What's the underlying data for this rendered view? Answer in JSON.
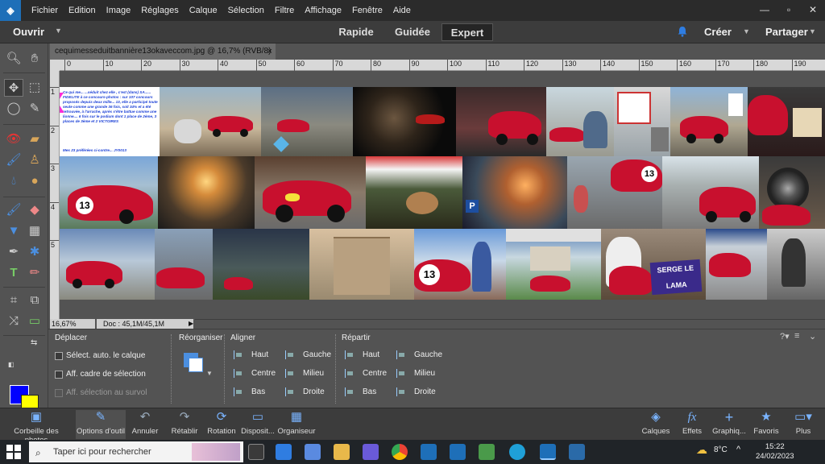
{
  "menu": [
    "Fichier",
    "Edition",
    "Image",
    "Réglages",
    "Calque",
    "Sélection",
    "Filtre",
    "Affichage",
    "Fenêtre",
    "Aide"
  ],
  "window_controls": [
    "—",
    "▫",
    "✕"
  ],
  "modebar": {
    "open": "Ouvrir",
    "tabs": [
      "Rapide",
      "Guidée",
      "Expert"
    ],
    "active_tab": "Expert",
    "create": "Créer",
    "share": "Partager"
  },
  "document": {
    "tab_title": "cequimesseduitbannière13okaveccom.jpg @ 16,7% (RVB/8)",
    "close": "×",
    "zoom": "16,67%",
    "doc_size": "Doc : 45,1M/45,1M"
  },
  "ruler_top": [
    "0",
    "10",
    "20",
    "30",
    "40",
    "50",
    "60",
    "70",
    "80",
    "90",
    "100",
    "110",
    "120",
    "130",
    "140",
    "150",
    "160",
    "170",
    "180",
    "190"
  ],
  "ruler_left": [
    "1",
    "2",
    "3",
    "4",
    "5"
  ],
  "canvas_text": {
    "collage_caption": "Ce qui me... ...séduit chez elle , c'est (dans) SA...... FIDELITE à ce concours-photos : sur 107 concours proposés depuis deux mille... 13, elle a participé toute seule comme une grande 36 fois, soit 34% et a été retrouvée, à l'arrache, après s'être battue comme une lionne.... 6 fois sur le podium dont 1 place de 2ème, 3 places de 3ème et 2 VICTOIRES",
    "collage_caption_footer": "Mes 23 préférées ci-contre... JY0013",
    "plate_13": "13",
    "sign_text": "SERGE LE LAMA"
  },
  "options": {
    "deplacer": {
      "title": "Déplacer",
      "items": [
        "Sélect. auto. le calque",
        "Aff. cadre de sélection",
        "Aff. sélection au survol"
      ]
    },
    "reorganiser": "Réorganiser",
    "aligner": {
      "title": "Aligner",
      "col1": [
        "Haut",
        "Centre",
        "Bas"
      ],
      "col2": [
        "Gauche",
        "Milieu",
        "Droite"
      ]
    },
    "repartir": {
      "title": "Répartir",
      "col1": [
        "Haut",
        "Centre",
        "Bas"
      ],
      "col2": [
        "Gauche",
        "Milieu",
        "Droite"
      ]
    }
  },
  "panelbar": {
    "left": [
      "Corbeille des photos",
      "Options d'outil",
      "Annuler",
      "Rétablir",
      "Rotation",
      "Disposit...",
      "Organiseur"
    ],
    "right": [
      "Calques",
      "Effets",
      "Graphiq...",
      "Favoris",
      "Plus"
    ]
  },
  "taskbar": {
    "search_placeholder": "Taper ici pour rechercher",
    "weather": "8°C",
    "time": "15:22",
    "date": "24/02/2023"
  },
  "colors": {
    "foreground": "#0000ff",
    "background": "#ffff00",
    "accent_blue": "#2f7de1",
    "car_red": "#c8102e"
  }
}
